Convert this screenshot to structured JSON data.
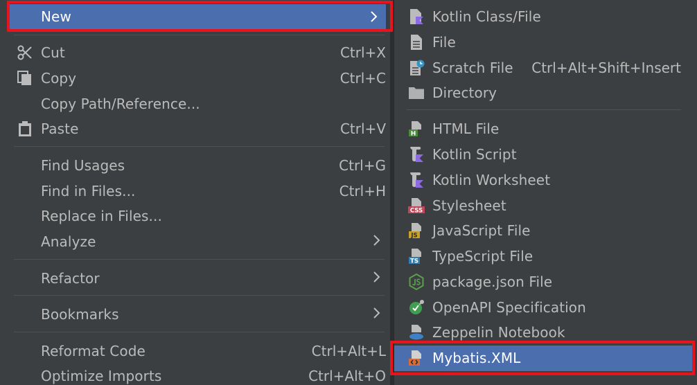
{
  "context_menu": {
    "items": [
      {
        "label": "New"
      },
      {
        "label": "Cut",
        "shortcut": "Ctrl+X"
      },
      {
        "label": "Copy",
        "shortcut": "Ctrl+C"
      },
      {
        "label": "Copy Path/Reference..."
      },
      {
        "label": "Paste",
        "shortcut": "Ctrl+V"
      },
      {
        "label": "Find Usages",
        "shortcut": "Ctrl+G"
      },
      {
        "label": "Find in Files...",
        "shortcut": "Ctrl+H"
      },
      {
        "label": "Replace in Files..."
      },
      {
        "label": "Analyze"
      },
      {
        "label": "Refactor"
      },
      {
        "label": "Bookmarks"
      },
      {
        "label": "Reformat Code",
        "shortcut": "Ctrl+Alt+L"
      },
      {
        "label": "Optimize Imports",
        "shortcut": "Ctrl+Alt+O"
      }
    ]
  },
  "new_submenu": {
    "items": [
      {
        "label": "Kotlin Class/File",
        "icon": "kotlin-file-icon"
      },
      {
        "label": "File",
        "icon": "file-icon"
      },
      {
        "label": "Scratch File",
        "shortcut": "Ctrl+Alt+Shift+Insert",
        "icon": "scratch-file-icon"
      },
      {
        "label": "Directory",
        "icon": "folder-icon"
      },
      {
        "label": "HTML File",
        "icon": "html-file-icon"
      },
      {
        "label": "Kotlin Script",
        "icon": "kotlin-script-icon"
      },
      {
        "label": "Kotlin Worksheet",
        "icon": "kotlin-worksheet-icon"
      },
      {
        "label": "Stylesheet",
        "icon": "css-file-icon"
      },
      {
        "label": "JavaScript File",
        "icon": "js-file-icon"
      },
      {
        "label": "TypeScript File",
        "icon": "ts-file-icon"
      },
      {
        "label": "package.json File",
        "icon": "nodejs-icon"
      },
      {
        "label": "OpenAPI Specification",
        "icon": "openapi-icon"
      },
      {
        "label": "Zeppelin Notebook",
        "icon": "zeppelin-icon"
      },
      {
        "label": "Mybatis.XML",
        "icon": "xml-file-icon"
      }
    ]
  },
  "icons": {
    "css_badge": "CSS",
    "js_badge": "JS",
    "ts_badge": "TS",
    "html_badge": "H"
  },
  "colors": {
    "selection": "#4b6eaf",
    "highlight_border": "#e8141d",
    "menu_background": "#3c3f41",
    "kotlin": "#8f6be3",
    "html": "#4a8c3c",
    "css": "#c0485a",
    "js": "#c8a02a",
    "ts": "#2f7fb4",
    "xml": "#d86d3b"
  }
}
